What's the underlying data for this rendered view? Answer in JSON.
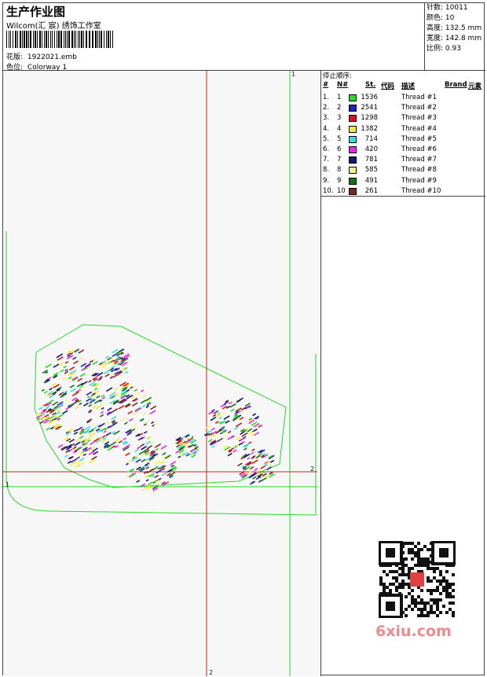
{
  "header": {
    "title": "生产作业图",
    "studio": "Wilcom(汇 宸) 绣饰工作室",
    "design_label": "花版:",
    "design_value": "1922021.emb",
    "colorway_label": "色位:",
    "colorway_value": "Colorway 1"
  },
  "stats": [
    {
      "label": "针数:",
      "value": "10011"
    },
    {
      "label": "颜色:",
      "value": "10"
    },
    {
      "label": "高度:",
      "value": "132.5 mm"
    },
    {
      "label": "宽度:",
      "value": "142.8 mm"
    },
    {
      "label": "比例:",
      "value": "0.93"
    }
  ],
  "legend": {
    "title": "停止顺序:",
    "columns": [
      "#",
      "N#",
      "St.",
      "代码",
      "描述",
      "Brand",
      "元素"
    ],
    "threads": [
      {
        "idx": "1.",
        "n": "1",
        "st": "1536",
        "desc": "Thread #1",
        "color": "#22dd22"
      },
      {
        "idx": "2.",
        "n": "2",
        "st": "2541",
        "desc": "Thread #2",
        "color": "#1a22cc"
      },
      {
        "idx": "3.",
        "n": "3",
        "st": "1298",
        "desc": "Thread #3",
        "color": "#dd1111"
      },
      {
        "idx": "4.",
        "n": "4",
        "st": "1382",
        "desc": "Thread #4",
        "color": "#f5ee22"
      },
      {
        "idx": "5.",
        "n": "5",
        "st": "714",
        "desc": "Thread #5",
        "color": "#33e0e0"
      },
      {
        "idx": "6.",
        "n": "6",
        "st": "420",
        "desc": "Thread #6",
        "color": "#ee22ee"
      },
      {
        "idx": "7.",
        "n": "7",
        "st": "781",
        "desc": "Thread #7",
        "color": "#101870"
      },
      {
        "idx": "8.",
        "n": "8",
        "st": "585",
        "desc": "Thread #8",
        "color": "#f8f080"
      },
      {
        "idx": "9.",
        "n": "9",
        "st": "491",
        "desc": "Thread #9",
        "color": "#117711"
      },
      {
        "idx": "10.",
        "n": "10",
        "st": "261",
        "desc": "Thread #10",
        "color": "#7a2a22"
      }
    ]
  },
  "guides": {
    "v1": "1",
    "v2": "2",
    "h1": "1",
    "h2": "2"
  },
  "watermark": "6xiu.com",
  "colors": {
    "red_guide": "#cc2222",
    "green_guide": "#22dd22"
  }
}
